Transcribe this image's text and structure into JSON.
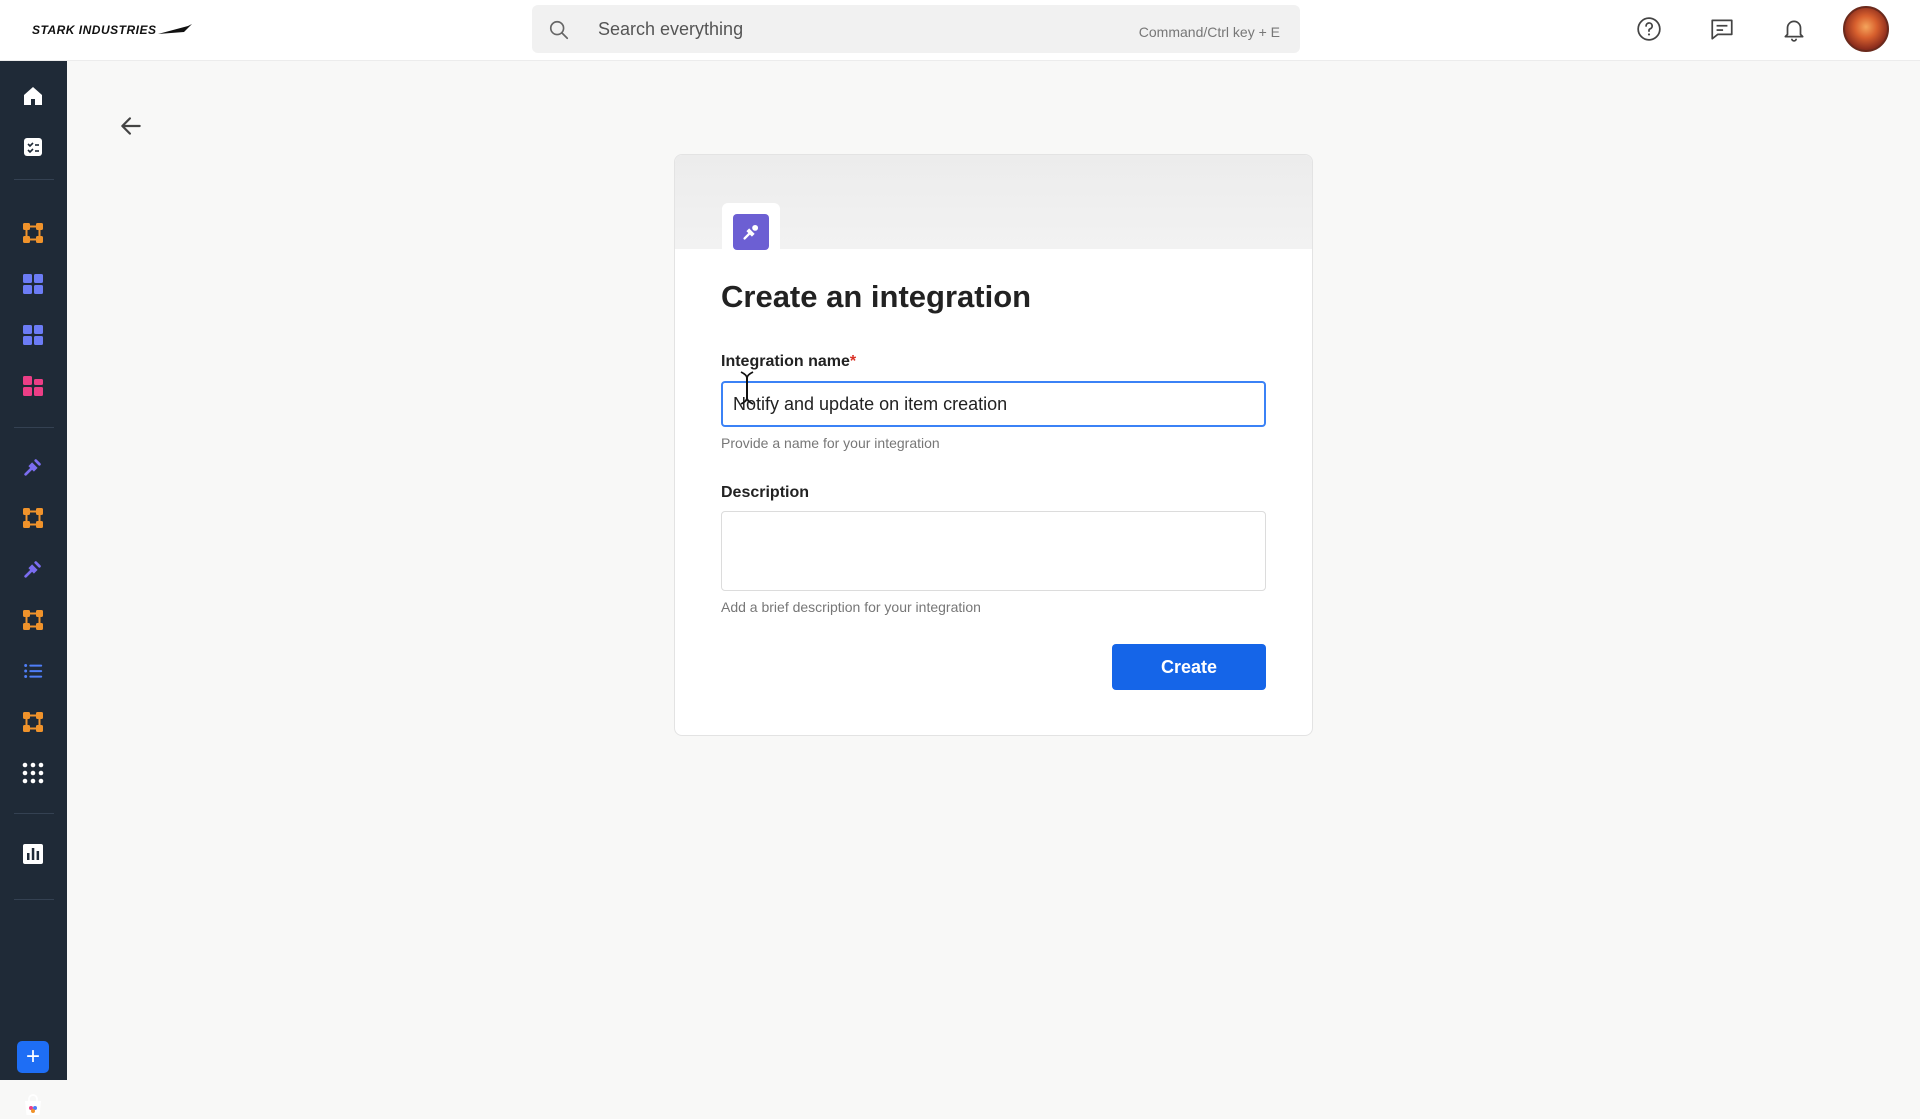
{
  "brand": {
    "logo_text": "STARK INDUSTRIES"
  },
  "search": {
    "placeholder": "Search everything",
    "shortcut": "Command/Ctrl key + E"
  },
  "topbar_icons": [
    "help-icon",
    "chat-icon",
    "bell-icon",
    "avatar"
  ],
  "sidebar": {
    "items": [
      {
        "name": "home-icon",
        "color": "#ffffff"
      },
      {
        "name": "tasks-icon",
        "color": "#ffffff"
      },
      {
        "name": "workflow-icon",
        "color": "#f0932b"
      },
      {
        "name": "dashboard-icon",
        "color": "#6c7cf5"
      },
      {
        "name": "dashboard-icon",
        "color": "#6c7cf5"
      },
      {
        "name": "apps-icon",
        "color": "#ec3e86"
      },
      {
        "name": "integration-icon",
        "color": "#7b6df0"
      },
      {
        "name": "workflow-icon",
        "color": "#f0932b"
      },
      {
        "name": "integration-icon",
        "color": "#7b6df0"
      },
      {
        "name": "workflow-icon",
        "color": "#f0932b"
      },
      {
        "name": "list-icon",
        "color": "#4f7ef7"
      },
      {
        "name": "workflow-icon",
        "color": "#f0932b"
      },
      {
        "name": "grid-menu-icon",
        "color": "#ffffff"
      },
      {
        "name": "reports-icon",
        "color": "#ffffff"
      }
    ],
    "add_button": "+"
  },
  "form": {
    "title": "Create an integration",
    "name_label": "Integration name",
    "required_mark": "*",
    "name_value": "Notify and update on item creation",
    "name_helper": "Provide a name for your integration",
    "description_label": "Description",
    "description_value": "",
    "description_helper": "Add a brief description for your integration",
    "create_label": "Create"
  },
  "colors": {
    "accent": "#1565e8",
    "sidebar_bg": "#1f2a37",
    "integration_purple": "#6c5fd3"
  }
}
